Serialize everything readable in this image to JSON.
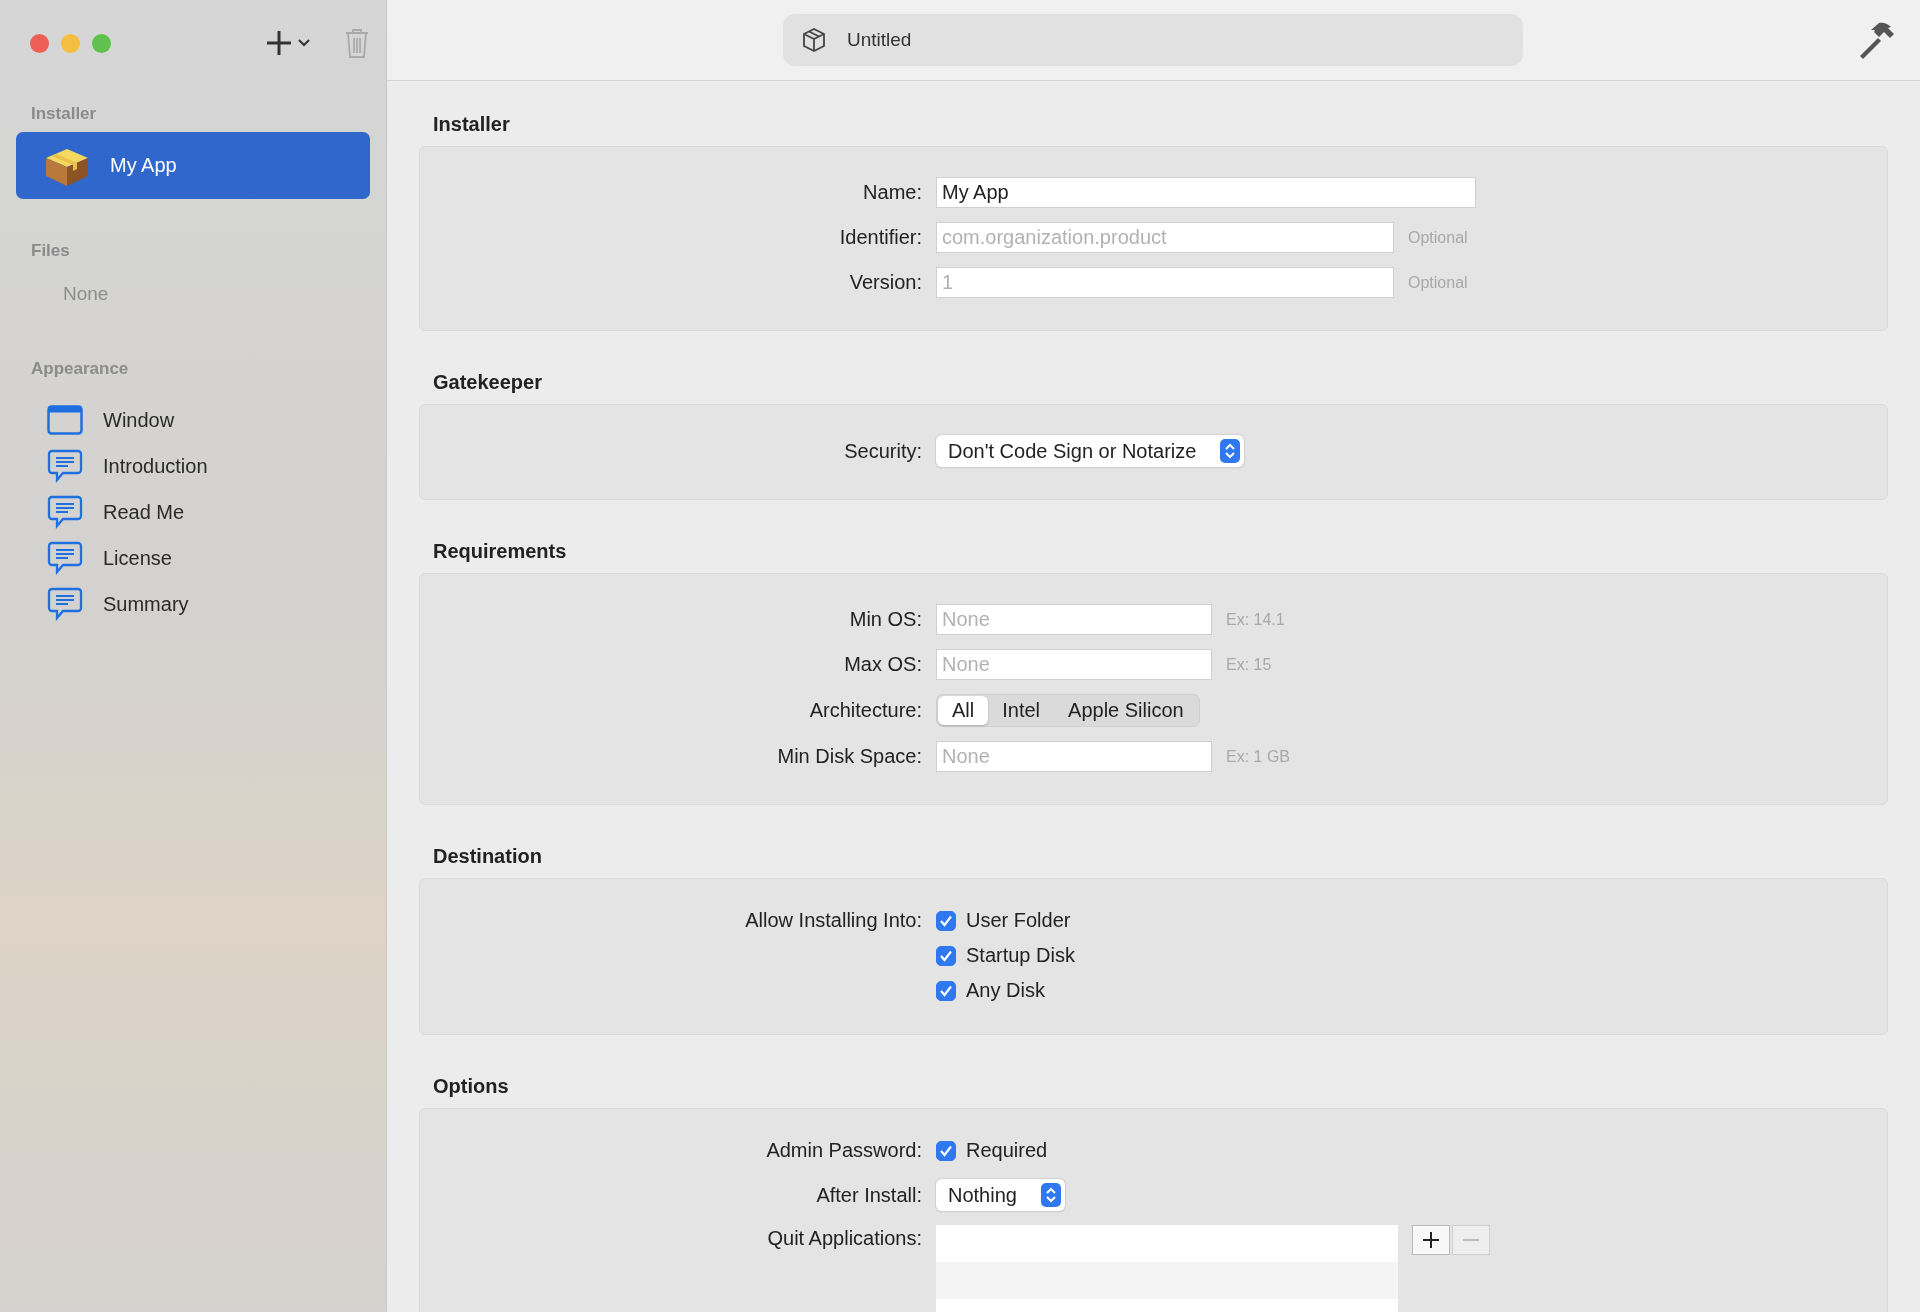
{
  "window": {
    "title": "Untitled"
  },
  "sidebar": {
    "sections": [
      {
        "heading": "Installer",
        "items": [
          {
            "label": "My App",
            "kind": "package",
            "selected": true
          }
        ]
      },
      {
        "heading": "Files",
        "empty_text": "None"
      },
      {
        "heading": "Appearance",
        "items": [
          {
            "label": "Window",
            "kind": "window",
            "selected": false
          },
          {
            "label": "Introduction",
            "kind": "text",
            "selected": false
          },
          {
            "label": "Read Me",
            "kind": "text",
            "selected": false
          },
          {
            "label": "License",
            "kind": "text",
            "selected": false
          },
          {
            "label": "Summary",
            "kind": "text",
            "selected": false
          }
        ]
      }
    ]
  },
  "sections": [
    {
      "title": "Installer",
      "rows": [
        {
          "kind": "field",
          "label": "Name:",
          "value": "My App"
        },
        {
          "kind": "field",
          "label": "Identifier:",
          "placeholder": "com.organization.product",
          "hint": "Optional"
        },
        {
          "kind": "field",
          "label": "Version:",
          "placeholder": "1",
          "hint": "Optional"
        }
      ]
    },
    {
      "title": "Gatekeeper",
      "rows": [
        {
          "kind": "popup",
          "label": "Security:",
          "value": "Don't Code Sign or Notarize"
        }
      ]
    },
    {
      "title": "Requirements",
      "rows": [
        {
          "kind": "field",
          "label": "Min OS:",
          "placeholder": "None",
          "hint": "Ex: 14.1"
        },
        {
          "kind": "field",
          "label": "Max OS:",
          "placeholder": "None",
          "hint": "Ex: 15"
        },
        {
          "kind": "segmented",
          "label": "Architecture:",
          "options": [
            {
              "label": "All",
              "selected": true
            },
            {
              "label": "Intel",
              "selected": false
            },
            {
              "label": "Apple Silicon",
              "selected": false
            }
          ]
        },
        {
          "kind": "field",
          "label": "Min Disk Space:",
          "placeholder": "None",
          "hint": "Ex: 1 GB"
        }
      ]
    },
    {
      "title": "Destination",
      "rows": [
        {
          "kind": "checks",
          "label": "Allow Installing Into:",
          "options": [
            {
              "label": "User Folder",
              "checked": true
            },
            {
              "label": "Startup Disk",
              "checked": true
            },
            {
              "label": "Any Disk",
              "checked": true
            }
          ]
        }
      ]
    },
    {
      "title": "Options",
      "rows": [
        {
          "kind": "checks",
          "label": "Admin Password:",
          "options": [
            {
              "label": "Required",
              "checked": true
            }
          ]
        },
        {
          "kind": "popup",
          "label": "After Install:",
          "value": "Nothing"
        },
        {
          "kind": "list",
          "label": "Quit Applications:"
        }
      ]
    }
  ]
}
